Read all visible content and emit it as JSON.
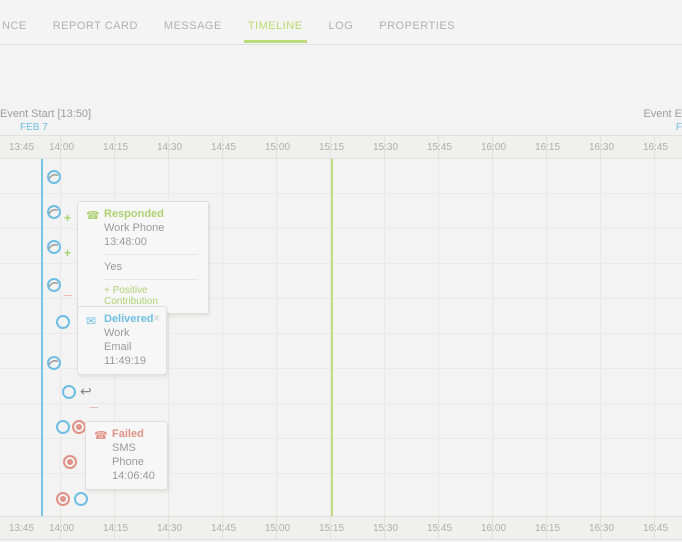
{
  "tabs": {
    "items": [
      {
        "label": "NCE"
      },
      {
        "label": "REPORT CARD"
      },
      {
        "label": "MESSAGE"
      },
      {
        "label": "TIMELINE"
      },
      {
        "label": "LOG"
      },
      {
        "label": "PROPERTIES"
      }
    ],
    "active_index": 3
  },
  "event_start": {
    "label": "Event Start [13:50]",
    "date": "FEB 7"
  },
  "event_end": {
    "label": "Event E",
    "date": "F"
  },
  "ruler": {
    "times": [
      "13:45",
      "14:00",
      "14:15",
      "14:30",
      "14:45",
      "15:00",
      "15:15",
      "15:30",
      "15:45",
      "16:00",
      "16:15",
      "16:30",
      "16:45"
    ]
  },
  "timeline": {
    "now_label": "15:15",
    "start_label": "13:50"
  },
  "cards": {
    "responded": {
      "title": "Responded",
      "line1": "Work Phone",
      "line2": "13:48:00",
      "answer": "Yes",
      "pos": "+ Positive Contribution"
    },
    "delivered": {
      "title": "Delivered",
      "line1": "Work Email",
      "line2": "11:49:19"
    },
    "failed": {
      "title": "Failed",
      "line1": "SMS Phone",
      "line2": "14:06:40"
    }
  },
  "colors": {
    "accent_green": "#a4cf3e",
    "accent_blue": "#2aa3dd",
    "accent_red": "#d9604d"
  }
}
